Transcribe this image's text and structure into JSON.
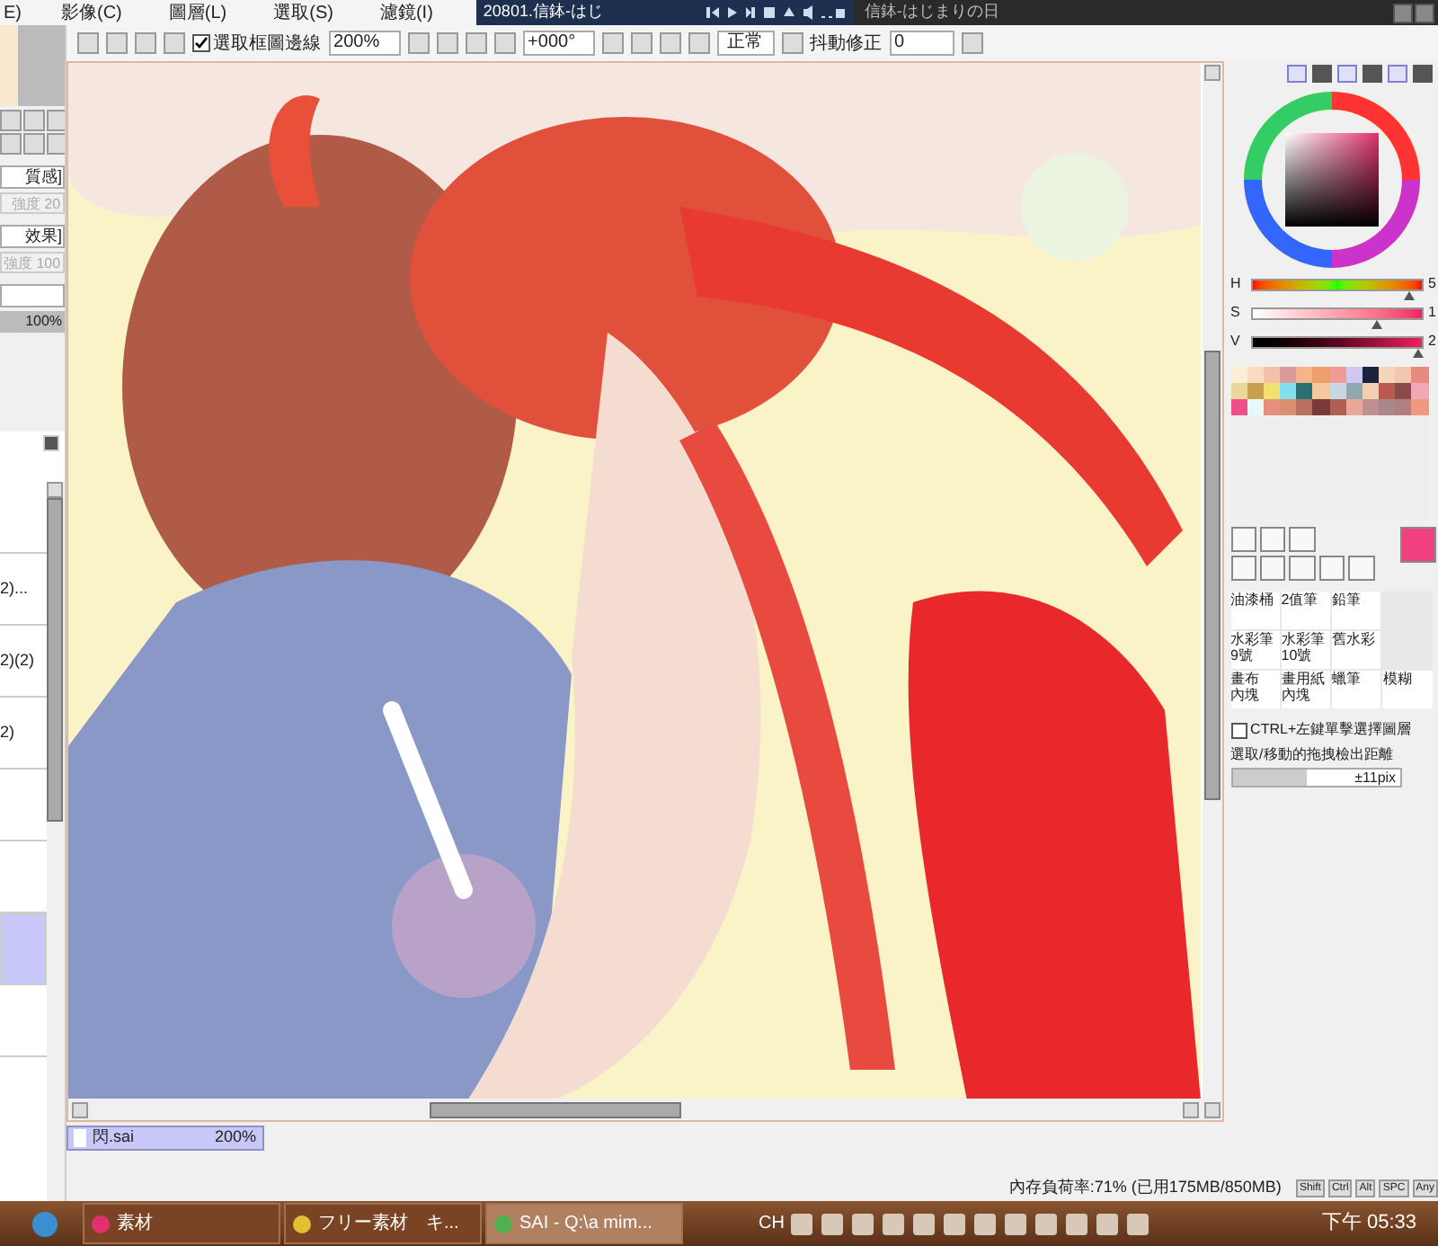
{
  "menu_bar": {
    "items": [
      {
        "label": "E)"
      },
      {
        "label": "影像(C)"
      },
      {
        "label": "圖層(L)"
      },
      {
        "label": "選取(S)"
      },
      {
        "label": "濾鏡(I)"
      }
    ]
  },
  "media_player": {
    "title": "20801.信鉢-はじ"
  },
  "window_title": "信鉢-はじまりの日",
  "toolbar": {
    "selection_edge": {
      "label": "選取框圖邊線",
      "checked": true
    },
    "zoom": "200%",
    "rotation": "+000°",
    "blend_mode": "正常",
    "stabilizer": {
      "label": "抖動修正",
      "value": "0"
    }
  },
  "left_panel": {
    "texture": {
      "value": "質感]",
      "strength": "強度 20"
    },
    "effect": {
      "value": "效果]",
      "strength": "強度 100"
    },
    "opacity": {
      "reading": "100%",
      "level": 1
    },
    "layers": [
      {
        "selected": false
      },
      {
        "name": "2)...",
        "selected": false
      },
      {
        "name": "2)(2)",
        "selected": false
      },
      {
        "name": "2)",
        "selected": false
      },
      {
        "selected": false
      },
      {
        "selected": false
      },
      {
        "selected": true
      },
      {
        "selected": false
      }
    ]
  },
  "color_panel": {
    "sliders": [
      {
        "label": "H",
        "value": "5",
        "level": 0.93
      },
      {
        "label": "S",
        "value": "1",
        "level": 0.74
      },
      {
        "label": "V",
        "value": "2",
        "level": 0.98
      }
    ],
    "swatches": [
      {
        "color": "#fbeed6"
      },
      {
        "color": "#f8dcc0"
      },
      {
        "color": "#f3c0a8"
      },
      {
        "color": "#d99a9a"
      },
      {
        "color": "#f5b58a"
      },
      {
        "color": "#eea06a"
      },
      {
        "color": "#f29a9a"
      },
      {
        "color": "#d0c8f0"
      },
      {
        "color": "#1a2240"
      },
      {
        "color": "#f6d6b8"
      },
      {
        "color": "#f2c7b0"
      },
      {
        "color": "#e88a80"
      },
      {
        "color": "#e8d89a"
      },
      {
        "color": "#c8a050"
      },
      {
        "color": "#f2e070"
      },
      {
        "color": "#80e0f0"
      },
      {
        "color": "#2a7070"
      },
      {
        "color": "#f5c8a0"
      },
      {
        "color": "#c8d8e0"
      },
      {
        "color": "#90a8b0"
      },
      {
        "color": "#f0d0b0"
      },
      {
        "color": "#b85a50"
      },
      {
        "color": "#8a4a48"
      },
      {
        "color": "#f0a8b8"
      },
      {
        "color": "#f0508a"
      },
      {
        "color": "#e8f8f8"
      },
      {
        "color": "#e89080"
      },
      {
        "color": "#d89070"
      },
      {
        "color": "#b87060"
      },
      {
        "color": "#7a3a3a"
      },
      {
        "color": "#b06050"
      },
      {
        "color": "#e8a898"
      },
      {
        "color": "#c09090"
      },
      {
        "color": "#a88888"
      },
      {
        "color": "#b08080"
      },
      {
        "color": "#f09880"
      }
    ],
    "current": {
      "color": "#f0407f"
    },
    "brush_rows": [
      [
        {
          "name": "油漆桶"
        },
        {
          "name": "2值筆"
        },
        {
          "name": "鉛筆"
        }
      ],
      [
        {
          "name": "水彩筆",
          "sub": "9號"
        },
        {
          "name": "水彩筆",
          "sub": "10號"
        },
        {
          "name": "舊水彩"
        }
      ],
      [
        {
          "name": "畫布",
          "sub": "內塊"
        },
        {
          "name": "畫用紙",
          "sub": "內塊"
        },
        {
          "name": "蠟筆"
        },
        {
          "name": "模糊"
        }
      ]
    ],
    "ctrl_select": {
      "label": "CTRL+左鍵單擊選擇圖層",
      "checked": false
    },
    "drag_distance": {
      "label": "選取/移動的拖拽檢出距離",
      "value": "±11pix",
      "level": 0.45
    }
  },
  "document_tabs": [
    {
      "name": "閃.sai",
      "zoom": "200%",
      "selected": true
    }
  ],
  "status_bar": {
    "memory": "內存負荷率:71% (已用175MB/850MB)",
    "keys": [
      "Shift",
      "Ctrl",
      "Alt",
      "SPC",
      "Any"
    ]
  },
  "taskbar": {
    "buttons": [
      {
        "label": "素材",
        "selected": false
      },
      {
        "label": "フリー素材　キ...",
        "selected": false
      },
      {
        "label": "SAI - Q:\\a mim...",
        "selected": true
      }
    ],
    "language": "CH",
    "clock": "下午 05:33"
  }
}
